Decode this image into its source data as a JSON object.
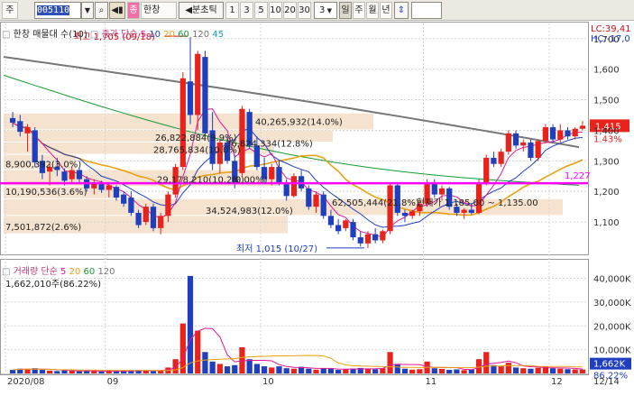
{
  "toolbar": {
    "code_prefix": "주",
    "stock_code": "005110",
    "company": "한창",
    "period_label": "분초틱",
    "periods": [
      "1",
      "3",
      "5",
      "10",
      "20",
      "30"
    ],
    "count_value": "3",
    "timeframes": [
      "일",
      "주",
      "월",
      "년"
    ],
    "input_value": ""
  },
  "price_panel": {
    "legend_title": "한창 매물대 수(10)",
    "ma_label": "종가 단순",
    "ma_periods": [
      "5",
      "10",
      "20",
      "60",
      "120",
      "45"
    ],
    "right_info": [
      "LC:39,41",
      "HC:-17,0"
    ],
    "y_ticks": [
      "1,700",
      "1,600",
      "1,500",
      "1,400",
      "1,300",
      "1,200",
      "1,100"
    ],
    "price_badge": "1,415",
    "change_badge": "1.43%",
    "hline_value": "1,227",
    "high_label": "최고 1,705 (09/18)",
    "low_label": "최저 1,015 (10/27)",
    "volume_profile": [
      "40,265,932(14.0%)",
      "26,822,884(9.9%)",
      "36,824,334(12.8%)",
      "28,765,834(10.0%)",
      "8,900,392(3.0%)",
      "29,178,210(10.2%)",
      "10,190,536(3.6%)",
      "62,505,444(21.8%)",
      "34,524,983(12.0%)",
      "7,501,872(2.6%)"
    ],
    "box_annotation": "현재가 1,185.00 ~ 1,135.00",
    "profile_note": "(0.00%)"
  },
  "volume_panel": {
    "legend_title": "거래량",
    "ma_label": "단순",
    "ma_periods": [
      "5",
      "20",
      "60",
      "120"
    ],
    "current_volume": "1,662,010주(86.22%)",
    "y_ticks": [
      "40,000K",
      "30,000K",
      "20,000K",
      "10,000K"
    ],
    "volume_badge": "1,662K",
    "pct_badge": "86.22%"
  },
  "x_axis": {
    "labels": [
      "2020/08",
      "09",
      "10",
      "11",
      "12",
      "12/14"
    ]
  },
  "colors": {
    "up": "#e8231b",
    "down": "#1f3fbf",
    "hline": "#ff00ff",
    "profile": "#f5e3cf"
  },
  "chart_data": {
    "type": "candlestick",
    "candles_ohlc": [
      [
        1440,
        1460,
        1410,
        1425
      ],
      [
        1430,
        1450,
        1380,
        1395
      ],
      [
        1390,
        1420,
        1330,
        1410
      ],
      [
        1400,
        1410,
        1280,
        1295
      ],
      [
        1300,
        1320,
        1240,
        1260
      ],
      [
        1265,
        1290,
        1220,
        1280
      ],
      [
        1280,
        1310,
        1250,
        1270
      ],
      [
        1265,
        1275,
        1220,
        1235
      ],
      [
        1240,
        1280,
        1230,
        1270
      ],
      [
        1270,
        1280,
        1230,
        1240
      ],
      [
        1240,
        1250,
        1200,
        1210
      ],
      [
        1210,
        1240,
        1190,
        1230
      ],
      [
        1225,
        1235,
        1195,
        1205
      ],
      [
        1205,
        1230,
        1180,
        1220
      ],
      [
        1215,
        1220,
        1170,
        1180
      ],
      [
        1190,
        1200,
        1150,
        1160
      ],
      [
        1180,
        1200,
        1120,
        1130
      ],
      [
        1130,
        1140,
        1080,
        1090
      ],
      [
        1100,
        1160,
        1090,
        1150
      ],
      [
        1150,
        1160,
        1070,
        1080
      ],
      [
        1080,
        1130,
        1060,
        1120
      ],
      [
        1120,
        1200,
        1100,
        1190
      ],
      [
        1190,
        1290,
        1180,
        1280
      ],
      [
        1280,
        1590,
        1270,
        1570
      ],
      [
        1560,
        1705,
        1420,
        1450
      ],
      [
        1450,
        1660,
        1400,
        1650
      ],
      [
        1640,
        1660,
        1380,
        1390
      ],
      [
        1400,
        1460,
        1270,
        1290
      ],
      [
        1290,
        1370,
        1260,
        1360
      ],
      [
        1360,
        1380,
        1290,
        1300
      ],
      [
        1300,
        1320,
        1210,
        1225
      ],
      [
        1260,
        1480,
        1250,
        1470
      ],
      [
        1460,
        1470,
        1340,
        1350
      ],
      [
        1350,
        1380,
        1270,
        1280
      ],
      [
        1280,
        1310,
        1230,
        1240
      ],
      [
        1240,
        1290,
        1220,
        1280
      ],
      [
        1280,
        1300,
        1220,
        1230
      ],
      [
        1230,
        1240,
        1170,
        1185
      ],
      [
        1185,
        1260,
        1180,
        1250
      ],
      [
        1250,
        1270,
        1200,
        1210
      ],
      [
        1210,
        1220,
        1140,
        1150
      ],
      [
        1150,
        1200,
        1130,
        1190
      ],
      [
        1190,
        1200,
        1110,
        1120
      ],
      [
        1120,
        1140,
        1080,
        1090
      ],
      [
        1090,
        1110,
        1060,
        1070
      ],
      [
        1080,
        1110,
        1070,
        1105
      ],
      [
        1100,
        1110,
        1040,
        1050
      ],
      [
        1050,
        1070,
        1020,
        1030
      ],
      [
        1030,
        1070,
        1015,
        1060
      ],
      [
        1060,
        1080,
        1030,
        1040
      ],
      [
        1040,
        1075,
        1030,
        1070
      ],
      [
        1070,
        1230,
        1060,
        1220
      ],
      [
        1220,
        1230,
        1120,
        1130
      ],
      [
        1130,
        1140,
        1100,
        1120
      ],
      [
        1120,
        1140,
        1110,
        1135
      ],
      [
        1135,
        1170,
        1120,
        1160
      ],
      [
        1160,
        1240,
        1150,
        1230
      ],
      [
        1230,
        1240,
        1180,
        1190
      ],
      [
        1190,
        1220,
        1170,
        1210
      ],
      [
        1210,
        1215,
        1140,
        1150
      ],
      [
        1150,
        1160,
        1120,
        1130
      ],
      [
        1130,
        1145,
        1110,
        1140
      ],
      [
        1140,
        1160,
        1125,
        1130
      ],
      [
        1130,
        1240,
        1125,
        1230
      ],
      [
        1230,
        1320,
        1220,
        1310
      ],
      [
        1310,
        1330,
        1280,
        1290
      ],
      [
        1290,
        1340,
        1280,
        1330
      ],
      [
        1330,
        1400,
        1320,
        1390
      ],
      [
        1390,
        1400,
        1340,
        1350
      ],
      [
        1350,
        1370,
        1330,
        1360
      ],
      [
        1360,
        1370,
        1300,
        1310
      ],
      [
        1310,
        1370,
        1300,
        1365
      ],
      [
        1365,
        1420,
        1360,
        1410
      ],
      [
        1410,
        1420,
        1360,
        1370
      ],
      [
        1370,
        1420,
        1360,
        1400
      ],
      [
        1400,
        1410,
        1370,
        1380
      ],
      [
        1380,
        1410,
        1370,
        1405
      ],
      [
        1405,
        1430,
        1400,
        1415
      ]
    ],
    "volumes_k": [
      1.5,
      2,
      1.8,
      2.2,
      1.5,
      1.2,
      1,
      1.3,
      1.1,
      0.9,
      1.2,
      1,
      0.8,
      1,
      0.9,
      1.1,
      1.3,
      1.5,
      1.4,
      1,
      1.2,
      2.5,
      6,
      21,
      41,
      18,
      9,
      5,
      4,
      3,
      3.5,
      11,
      6,
      4,
      3,
      2.5,
      3,
      2.2,
      2,
      2.8,
      2,
      1.6,
      2.2,
      2,
      1.5,
      1.7,
      2,
      2.3,
      2.1,
      1.8,
      2.2,
      9,
      4,
      2,
      1.6,
      1.8,
      5,
      2.2,
      1.9,
      1.5,
      1.7,
      1.4,
      1.6,
      6,
      9,
      3.5,
      3,
      4.5,
      2.5,
      2.2,
      2,
      2.4,
      3,
      2.2,
      2,
      1.8,
      1.7,
      1.662
    ],
    "moving_average_values": {
      "ma120_start": 1640,
      "ma120_end": 1345,
      "ma60_start": 1580,
      "ma60_end": 1220,
      "ma20_start": 1400,
      "ma20_end": 1300
    },
    "hline": 1227,
    "y_range": [
      1000,
      1720
    ],
    "vol_range_k": [
      0,
      44
    ]
  }
}
